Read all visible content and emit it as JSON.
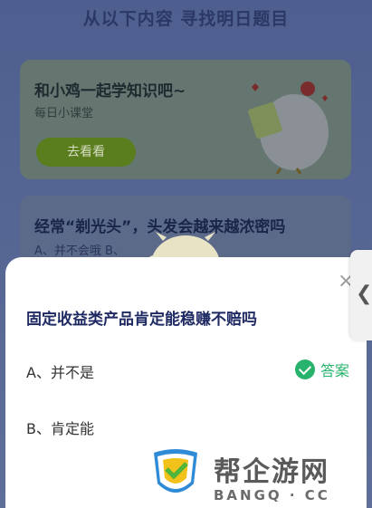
{
  "background": {
    "header_title": "从以下内容 寻找明日题目",
    "card1": {
      "title": "和小鸡一起学知识吧~",
      "subtitle": "每日小课堂",
      "button_label": "去看看"
    },
    "card2": {
      "title": "经常“剃光头”，头发会越来越浓密吗",
      "options_preview": "A、并不会哦    B、"
    }
  },
  "sheet": {
    "close_icon": "close-icon",
    "question": "固定收益类产品肯定能稳赚不赔吗",
    "option_a": "A、并不是",
    "option_b": "B、肯定能",
    "answer_label": "答案",
    "answer_color": "#27b36b"
  },
  "side_handle": {
    "icon": "chevron-left-icon",
    "glyph": "❮"
  },
  "watermark": {
    "brand": "帮企游网",
    "domain": "BANGQ · CC"
  }
}
